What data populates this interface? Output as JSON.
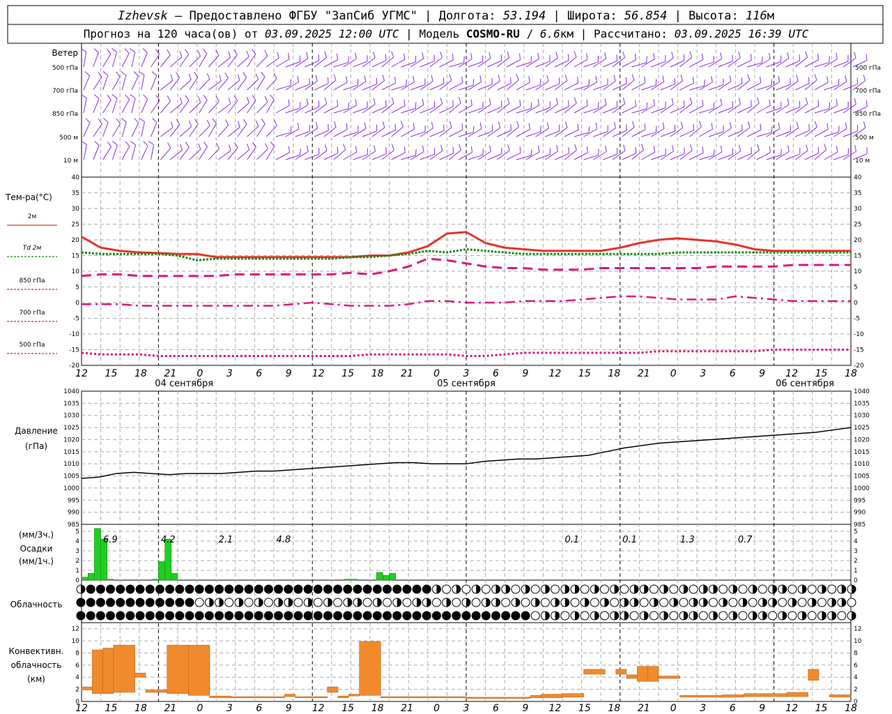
{
  "header": {
    "city": "Izhevsk",
    "dash": "–",
    "provider": "Предоставлено ФГБУ \"ЗапСиб УГМС\"",
    "lon_label": "Долгота:",
    "lon": "53.194",
    "lat_label": "Широта:",
    "lat": "56.854",
    "alt_label": "Высота:",
    "alt": "116",
    "alt_unit": "м",
    "forecast_prefix": "Прогноз на 120 часа(ов) от",
    "forecast_time": "03.09.2025 12:00 UTC",
    "model_label": "Модель",
    "model": "COSMO-RU",
    "resolution": "6.6",
    "res_unit": "км",
    "computed_label": "Рассчитано:",
    "computed_time": "03.09.2025 16:39 UTC"
  },
  "labels": {
    "wind_title": "Ветер",
    "wind_levels": [
      "500 гПа",
      "700 гПа",
      "850 гПа",
      "500 м",
      "10 м"
    ],
    "temp_title": "Тем-ра(°C)",
    "temp_legend": [
      "2м",
      "Td 2м",
      "850 гПа",
      "700 гПа",
      "500 гПа"
    ],
    "pressure_title": "Давление",
    "pressure_unit": "(гПа)",
    "precip_unit_top": "(мм/3ч.)",
    "precip_title": "Осадки",
    "precip_unit_bottom": "(мм/1ч.)",
    "cloud_title": "Облачность",
    "conv_title": [
      "Конвективн.",
      "облачность",
      "(км)"
    ]
  },
  "axis": {
    "hour_ticks": [
      "12",
      "15",
      "18",
      "21",
      "0",
      "3",
      "6",
      "9",
      "12",
      "15",
      "18",
      "21",
      "0",
      "3",
      "6",
      "9",
      "12",
      "15",
      "18",
      "21",
      "0",
      "3",
      "6",
      "9",
      "12",
      "15",
      "18"
    ],
    "dates": [
      "04 сентября",
      "05 сентября",
      "06 сентября"
    ]
  },
  "colors": {
    "wind": "#8a2be2",
    "t2m": "#e8312b",
    "td2m": "#138a13",
    "t850": "#e0157a",
    "t700": "#e0157a",
    "t500": "#e0157a",
    "pressure": "#000000",
    "precip": "#1fcf1f",
    "conv": "#f08a2c"
  },
  "chart_data": [
    {
      "type": "line",
      "title": "Тем-ра(°C)",
      "x_hours": [
        0,
        3,
        6,
        9,
        12,
        15,
        18,
        21,
        24,
        27,
        30,
        33,
        36,
        39,
        42,
        45,
        48,
        51,
        54,
        57,
        60,
        63,
        66,
        69,
        72,
        75,
        78,
        81,
        84,
        87,
        90,
        93,
        96,
        99,
        102,
        105,
        108,
        111,
        114,
        117,
        120
      ],
      "ylim": [
        -20,
        40
      ],
      "series": [
        {
          "name": "2м",
          "values": [
            21,
            17.5,
            16.5,
            16,
            15.8,
            15.5,
            15.5,
            14.5,
            14.5,
            14.5,
            14.5,
            14.5,
            14.5,
            14.5,
            14.5,
            15,
            15,
            16,
            18,
            22,
            22.5,
            19,
            17.5,
            17,
            16.5,
            16.5,
            16.5,
            16.5,
            17.5,
            19,
            20,
            20.5,
            20,
            19.5,
            18.5,
            17,
            16.5,
            16.5,
            16.5,
            16.5,
            16.5
          ]
        },
        {
          "name": "Td 2м",
          "values": [
            16,
            15.5,
            15.5,
            15.5,
            15.5,
            15,
            13.5,
            14,
            14,
            14,
            14,
            14,
            14,
            14,
            14.5,
            14.5,
            15,
            15.5,
            16.5,
            16,
            17,
            16.5,
            16,
            15.5,
            15.5,
            15.5,
            15.5,
            15.5,
            15.5,
            15.5,
            15.5,
            16,
            16,
            16,
            16,
            16,
            16,
            16,
            16,
            16,
            16
          ]
        },
        {
          "name": "850 гПа",
          "values": [
            8.5,
            9,
            9,
            8.5,
            8.5,
            8.5,
            8.5,
            8.5,
            9,
            9,
            9,
            9,
            9,
            9,
            9.5,
            9,
            10,
            11.5,
            14,
            13.5,
            12.5,
            11.5,
            11,
            11,
            10.5,
            10.5,
            10.5,
            11,
            11,
            11,
            11,
            11,
            11,
            11.5,
            11.5,
            11.5,
            11.5,
            12,
            12,
            12,
            12
          ]
        },
        {
          "name": "700 гПа",
          "values": [
            -0.5,
            -0.5,
            -0.5,
            -1,
            -1,
            -1,
            -1,
            -1,
            -1,
            -1,
            -1,
            -0.5,
            0,
            -0.5,
            -1,
            -1,
            -1,
            -0.5,
            0.5,
            0.5,
            0,
            0,
            0,
            0.5,
            0.5,
            0.5,
            1,
            1.5,
            2,
            2,
            1.5,
            1,
            1,
            1,
            2,
            1.5,
            1,
            0.5,
            0.5,
            0.5,
            0.5
          ]
        },
        {
          "name": "500 гПа",
          "values": [
            -16,
            -16.5,
            -16.5,
            -16.5,
            -17,
            -17,
            -17,
            -17,
            -17,
            -17,
            -17,
            -17,
            -17,
            -17,
            -17,
            -16.5,
            -16.5,
            -16.5,
            -16.5,
            -16.5,
            -17,
            -17,
            -16.5,
            -16,
            -16,
            -16,
            -16,
            -16,
            -16,
            -16,
            -15.5,
            -15.5,
            -15.5,
            -15.5,
            -15.5,
            -15.5,
            -15,
            -15,
            -15,
            -15,
            -15
          ]
        }
      ]
    },
    {
      "type": "line",
      "title": "Давление",
      "ylabel": "(гПа)",
      "ylim": [
        985,
        1040
      ],
      "x_hours": [
        0,
        2,
        4,
        6,
        8,
        10,
        12,
        15,
        18,
        21,
        24,
        27,
        30,
        33,
        36,
        39,
        42,
        45,
        48,
        51,
        54,
        57,
        60,
        63,
        66,
        69,
        72,
        75,
        78,
        81,
        84,
        87,
        90,
        93,
        96,
        99,
        102,
        105,
        108,
        111,
        114,
        117,
        120
      ],
      "series": [
        {
          "name": "Давление",
          "values": [
            1004,
            1004.5,
            1006,
            1006.5,
            1006,
            1005.5,
            1006,
            1006,
            1006,
            1006.5,
            1007,
            1007,
            1007.5,
            1008,
            1008.5,
            1009,
            1009.5,
            1010,
            1010.5,
            1010.5,
            1010,
            1010,
            1010,
            1011,
            1011.5,
            1012,
            1012,
            1012.5,
            1013,
            1013.5,
            1015,
            1016.5,
            1017.5,
            1018.5,
            1019,
            1019.5,
            1020,
            1020.5,
            1021,
            1021.5,
            1022,
            1022.5,
            1023,
            1024,
            1025
          ]
        }
      ]
    },
    {
      "type": "bar",
      "title": "Осадки",
      "ylabel": "(мм/1ч.)",
      "ylim": [
        0,
        5
      ],
      "bar_width_hours": 1,
      "x_hours": [
        0,
        1,
        2,
        3,
        4,
        5,
        6,
        7,
        8,
        9,
        10,
        11,
        12,
        13,
        14,
        15,
        16,
        17,
        18,
        19,
        20,
        21,
        22,
        23,
        24,
        25,
        26,
        27,
        28,
        29,
        30,
        31,
        32,
        33,
        34,
        35,
        36,
        37,
        38,
        39,
        40,
        41,
        42,
        43,
        44,
        45,
        46,
        47
      ],
      "values": [
        0.3,
        0.7,
        5.3,
        4.2,
        0.1,
        0,
        0,
        0,
        0,
        0,
        0,
        0.1,
        1.9,
        4.2,
        0.7,
        0,
        0,
        0,
        0,
        0,
        0,
        0,
        0,
        0,
        0,
        0,
        0,
        0,
        0,
        0,
        0,
        0,
        0,
        0,
        0,
        0,
        0,
        0,
        0,
        0,
        0,
        0.1,
        0.1,
        0,
        0,
        0,
        0.8,
        0.5,
        0.7
      ],
      "labels": [
        {
          "hour": 1.5,
          "text": "6.9"
        },
        {
          "hour": 4.5,
          "text": "4.2"
        },
        {
          "hour": 7.5,
          "text": "2.1"
        },
        {
          "hour": 10.5,
          "text": "4.8"
        },
        {
          "hour": 25.5,
          "text": "0.1"
        },
        {
          "hour": 28.5,
          "text": "0.1"
        },
        {
          "hour": 31.5,
          "text": "1.3"
        },
        {
          "hour": 34.5,
          "text": "0.7"
        }
      ]
    },
    {
      "type": "bar",
      "title": "Конвективн. облачность",
      "ylabel": "(км)",
      "ylim": [
        0,
        13
      ],
      "segments": [
        {
          "start": 0,
          "end": 1,
          "bottom": 1.9,
          "top": 2.4
        },
        {
          "start": 1,
          "end": 2,
          "bottom": 1.3,
          "top": 8.5
        },
        {
          "start": 2,
          "end": 3,
          "bottom": 1.3,
          "top": 8.8
        },
        {
          "start": 3,
          "end": 5,
          "bottom": 1.5,
          "top": 9.3
        },
        {
          "start": 5,
          "end": 6,
          "bottom": 4,
          "top": 4.7
        },
        {
          "start": 6,
          "end": 8,
          "bottom": 1.5,
          "top": 1.9
        },
        {
          "start": 8,
          "end": 10,
          "bottom": 1.3,
          "top": 9.3
        },
        {
          "start": 10,
          "end": 12,
          "bottom": 1,
          "top": 9.3
        },
        {
          "start": 12,
          "end": 14,
          "bottom": 0.6,
          "top": 0.9
        },
        {
          "start": 14,
          "end": 19,
          "bottom": 0.6,
          "top": 0.8
        },
        {
          "start": 19,
          "end": 20,
          "bottom": 0.8,
          "top": 1.2
        },
        {
          "start": 20,
          "end": 23,
          "bottom": 0.6,
          "top": 0.8
        },
        {
          "start": 23,
          "end": 24,
          "bottom": 1.5,
          "top": 2.4
        },
        {
          "start": 24,
          "end": 25,
          "bottom": 0.6,
          "top": 0.9
        },
        {
          "start": 25,
          "end": 26,
          "bottom": 0.9,
          "top": 1.2
        },
        {
          "start": 26,
          "end": 28,
          "bottom": 1,
          "top": 9.9
        },
        {
          "start": 28,
          "end": 36,
          "bottom": 0.6,
          "top": 0.8
        },
        {
          "start": 36,
          "end": 42,
          "bottom": 0.5,
          "top": 0.7
        },
        {
          "start": 42,
          "end": 43,
          "bottom": 0.6,
          "top": 1
        },
        {
          "start": 43,
          "end": 45,
          "bottom": 0.6,
          "top": 1.2
        },
        {
          "start": 45,
          "end": 47,
          "bottom": 0.7,
          "top": 1.3
        },
        {
          "start": 47,
          "end": 49,
          "bottom": 4.5,
          "top": 5.3
        },
        {
          "start": 50,
          "end": 51,
          "bottom": 4.5,
          "top": 5.3
        },
        {
          "start": 51,
          "end": 52,
          "bottom": 3.8,
          "top": 4.4
        },
        {
          "start": 52,
          "end": 53,
          "bottom": 3.3,
          "top": 5.8
        },
        {
          "start": 53,
          "end": 54,
          "bottom": 3.3,
          "top": 5.8
        },
        {
          "start": 54,
          "end": 56,
          "bottom": 3.8,
          "top": 4.2
        },
        {
          "start": 56,
          "end": 60,
          "bottom": 0.7,
          "top": 1
        },
        {
          "start": 60,
          "end": 62,
          "bottom": 0.7,
          "top": 1.1
        },
        {
          "start": 62,
          "end": 66,
          "bottom": 0.8,
          "top": 1.3
        },
        {
          "start": 66,
          "end": 68,
          "bottom": 0.8,
          "top": 1.5
        },
        {
          "start": 68,
          "end": 69,
          "bottom": 3.5,
          "top": 5.3
        },
        {
          "start": 70,
          "end": 72,
          "bottom": 0.7,
          "top": 1.1
        }
      ]
    }
  ]
}
